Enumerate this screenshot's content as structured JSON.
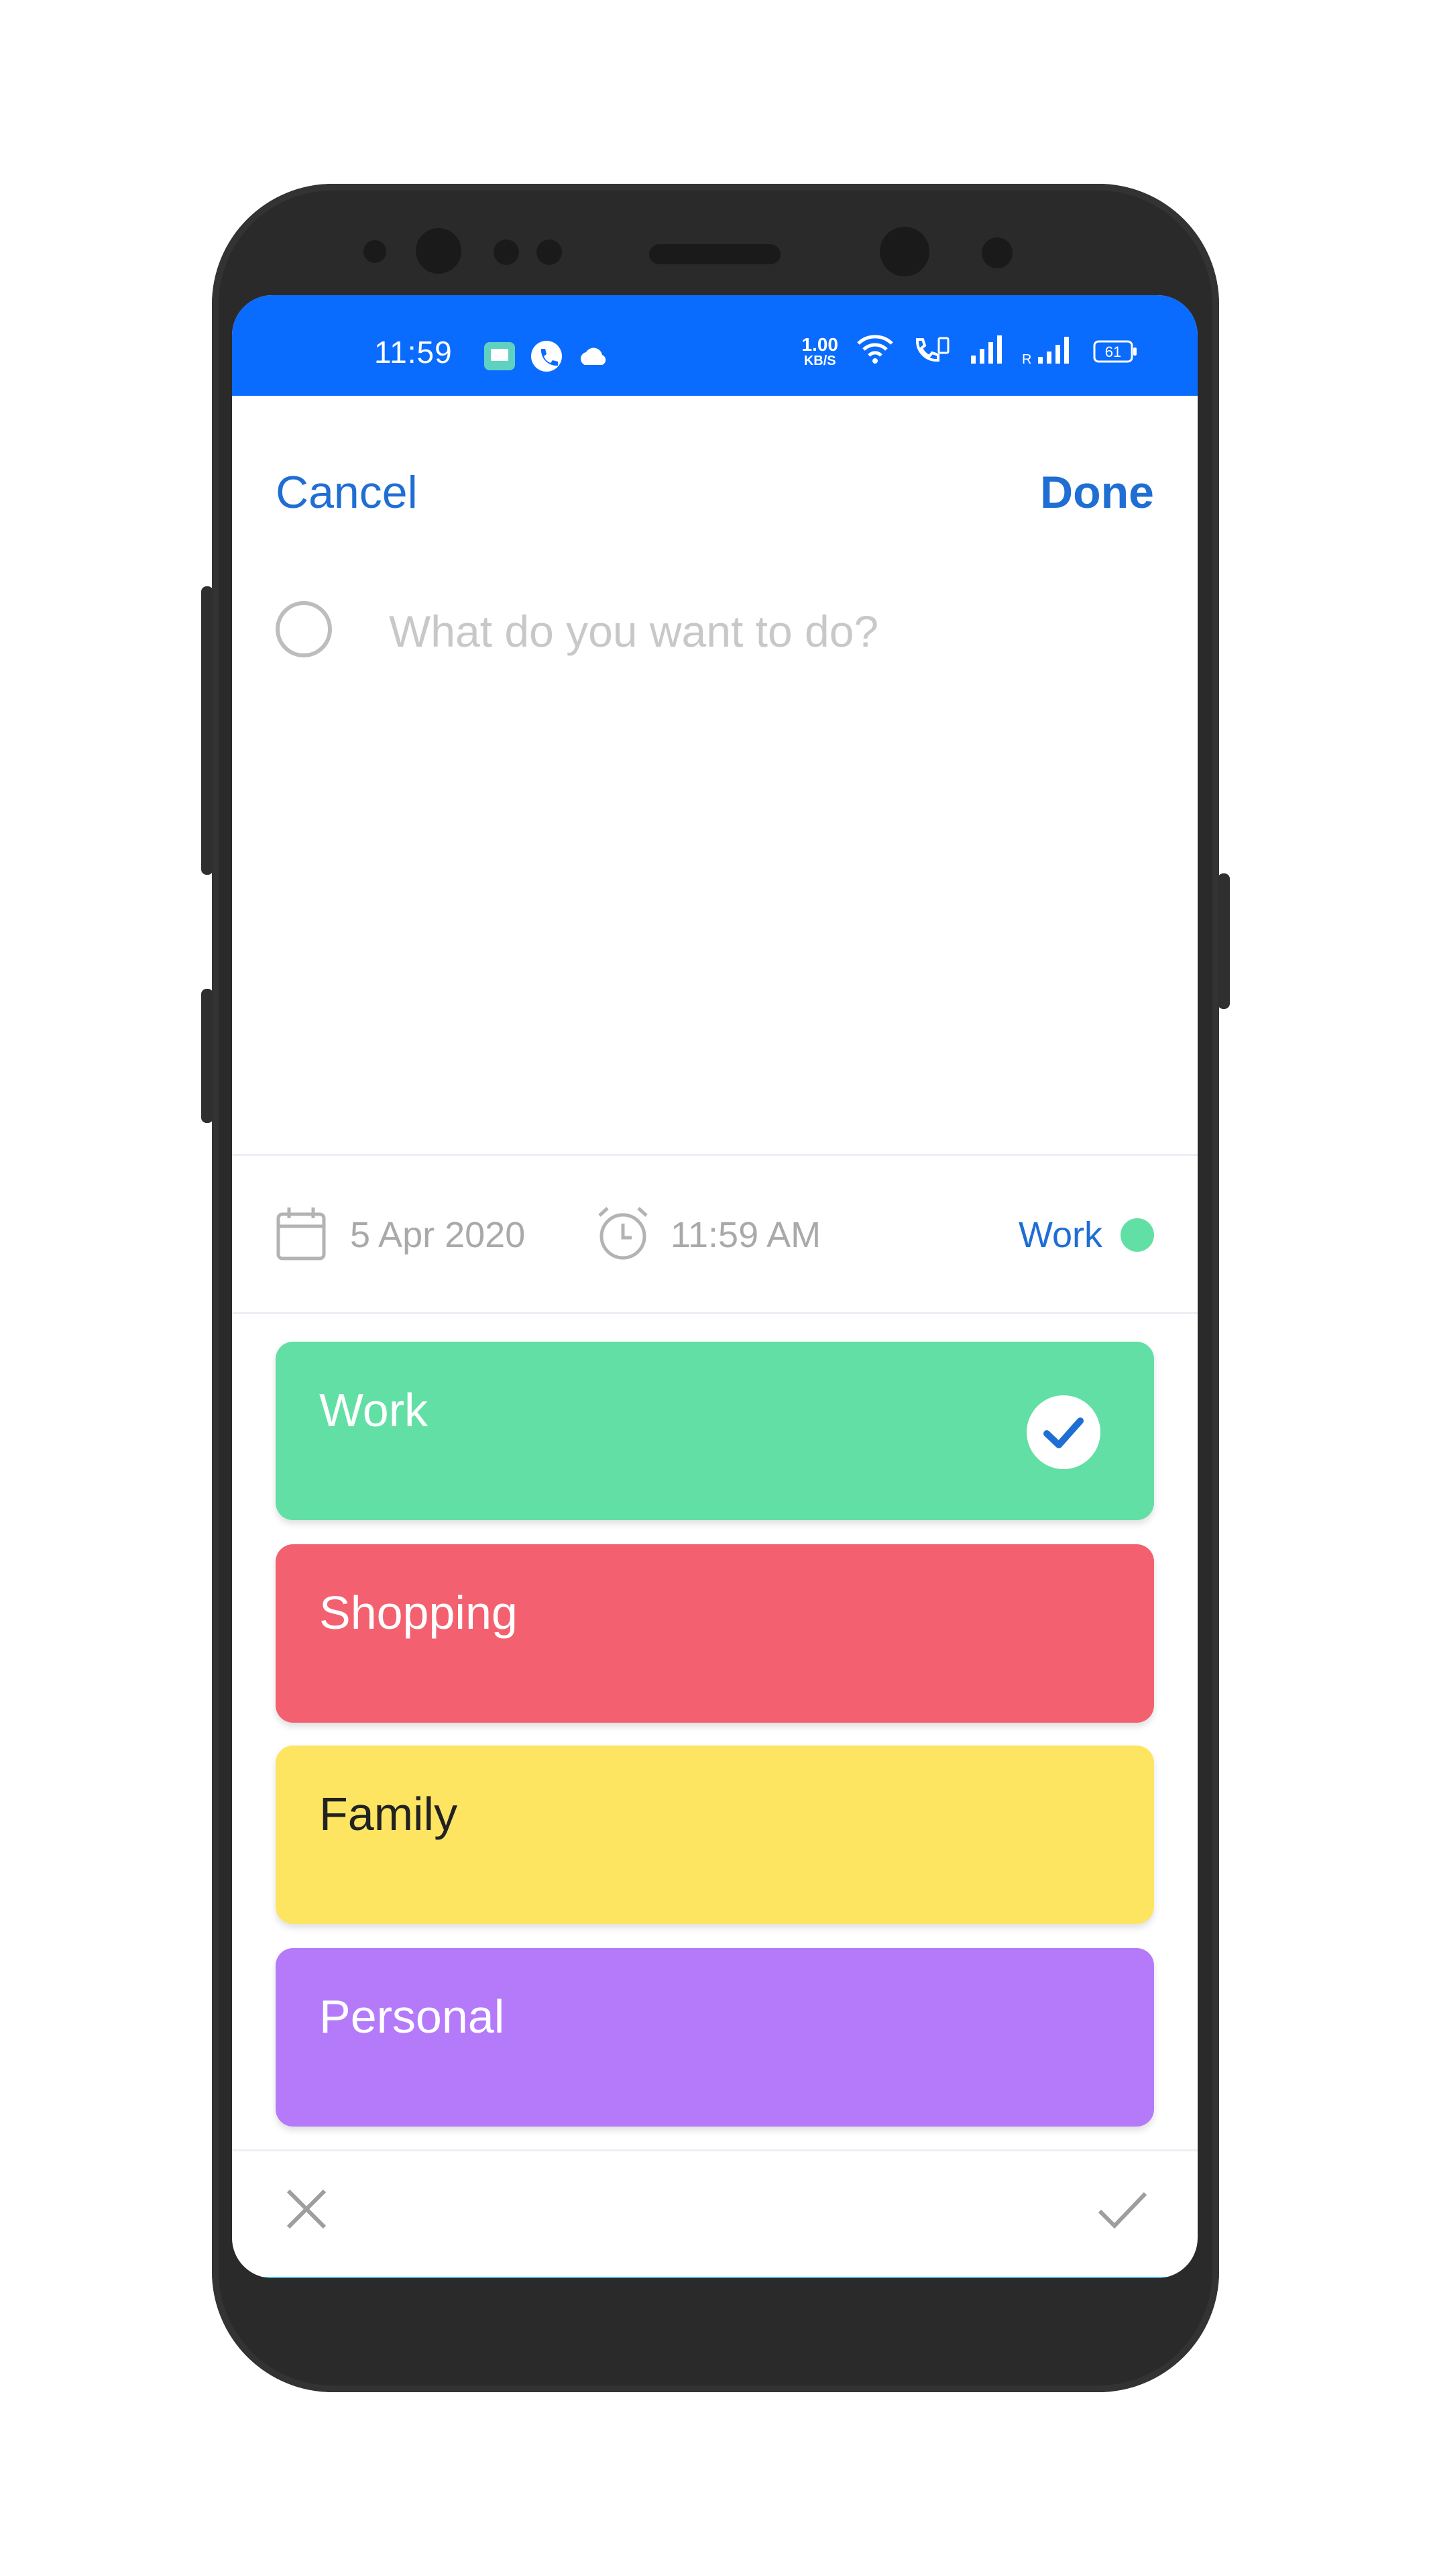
{
  "status_bar": {
    "time": "11:59",
    "speed_value": "1.00",
    "speed_unit": "KB/S",
    "battery": "61",
    "icons": [
      "message-icon",
      "phone-icon",
      "cloud-icon",
      "wifi-icon",
      "wifi-calling-icon",
      "signal-icon",
      "roaming-signal-icon",
      "battery-icon"
    ],
    "bg_color": "#0a6cff"
  },
  "header": {
    "cancel_label": "Cancel",
    "done_label": "Done"
  },
  "task": {
    "value": "",
    "placeholder": "What do you want to do?"
  },
  "meta": {
    "date": "5 Apr 2020",
    "time": "11:59 AM",
    "category": "Work",
    "category_color": "#62dfa5"
  },
  "categories": [
    {
      "label": "Work",
      "color": "#62dfa5",
      "text_color": "#ffffff",
      "selected": true
    },
    {
      "label": "Shopping",
      "color": "#f3606f",
      "text_color": "#ffffff",
      "selected": false
    },
    {
      "label": "Family",
      "color": "#fde562",
      "text_color": "#222222",
      "selected": false
    },
    {
      "label": "Personal",
      "color": "#b47afa",
      "text_color": "#ffffff",
      "selected": false
    }
  ],
  "bottom_bar": {
    "icons": [
      "close-icon",
      "checkmark-icon"
    ]
  },
  "accent_color": "#1f6ed4"
}
